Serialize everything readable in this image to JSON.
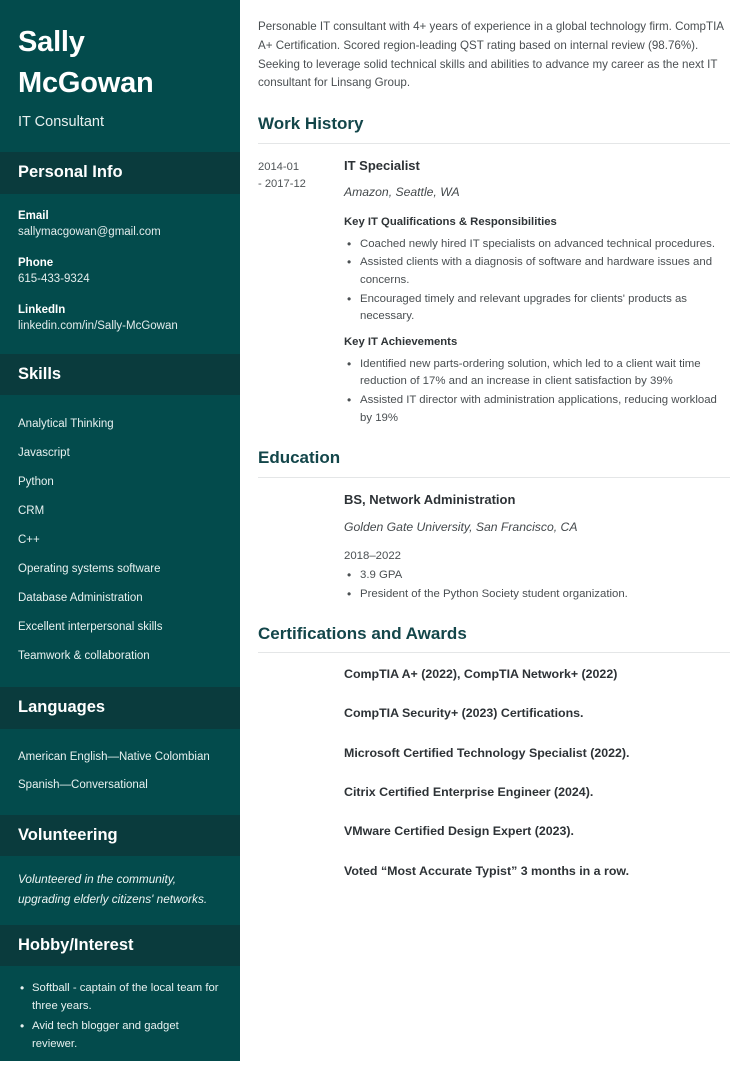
{
  "theme": {
    "sidebar_bg": "#034b4c",
    "sidebar_header_bg": "#0a3b3d",
    "heading_color": "#13464a",
    "body_text": "#4a4f52",
    "rule_color": "#e4e6e7"
  },
  "sidebar": {
    "name_first": "Sally",
    "name_last": "McGowan",
    "job_title": "IT Consultant",
    "personal_info": {
      "heading": "Personal Info",
      "items": [
        {
          "label": "Email",
          "value": "sallymacgowan@gmail.com"
        },
        {
          "label": "Phone",
          "value": "615-433-9324"
        },
        {
          "label": "LinkedIn",
          "value": "linkedin.com/in/Sally-McGowan"
        }
      ]
    },
    "skills": {
      "heading": "Skills",
      "items": [
        "Analytical Thinking",
        "Javascript",
        "Python",
        "CRM",
        "C++",
        "Operating systems software",
        "Database Administration",
        "Excellent interpersonal skills",
        "Teamwork & collaboration"
      ]
    },
    "languages": {
      "heading": "Languages",
      "items": [
        "American English—Native Colombian",
        "Spanish—Conversational"
      ]
    },
    "volunteering": {
      "heading": "Volunteering",
      "text": "Volunteered in the community, upgrading elderly citizens' networks."
    },
    "hobby": {
      "heading": "Hobby/Interest",
      "items": [
        "Softball - captain of the local team for three years.",
        "Avid tech blogger and gadget reviewer."
      ]
    }
  },
  "main": {
    "summary": "Personable IT consultant with 4+ years of experience in a global technology firm. CompTIA A+ Certification. Scored region-leading QST rating based on internal review (98.76%). Seeking to leverage solid technical skills and abilities to advance my career as the next IT consultant for Linsang Group.",
    "work_history": {
      "heading": "Work History",
      "entries": [
        {
          "date_start": "2014-01",
          "date_end": "- 2017-12",
          "role": "IT Specialist",
          "org": "Amazon, Seattle, WA",
          "group_one_label": "Key IT Qualifications & Responsibilities",
          "group_one_bullets": [
            "Coached newly hired IT specialists on advanced technical procedures.",
            "Assisted clients with a diagnosis of software and hardware issues and concerns.",
            "Encouraged timely and relevant upgrades for clients' products as necessary."
          ],
          "group_two_label": "Key IT Achievements",
          "group_two_bullets": [
            "Identified new parts-ordering solution, which led to a client wait time reduction of 17% and an increase in client satisfaction by 39%",
            "Assisted IT director with administration applications, reducing workload by 19%"
          ]
        }
      ]
    },
    "education": {
      "heading": "Education",
      "degree": "BS, Network Administration",
      "school": "Golden Gate University, San Francisco, CA",
      "years": "2018–2022",
      "bullets": [
        "3.9 GPA",
        "President of the Python Society student organization."
      ]
    },
    "certifications": {
      "heading": "Certifications and Awards",
      "items": [
        "CompTIA A+ (2022), CompTIA Network+ (2022)",
        "CompTIA Security+ (2023) Certifications.",
        "Microsoft Certified Technology Specialist (2022).",
        "Citrix Certified Enterprise Engineer (2024).",
        "VMware Certified Design Expert (2023).",
        "Voted “Most Accurate Typist” 3 months in a row."
      ]
    }
  }
}
